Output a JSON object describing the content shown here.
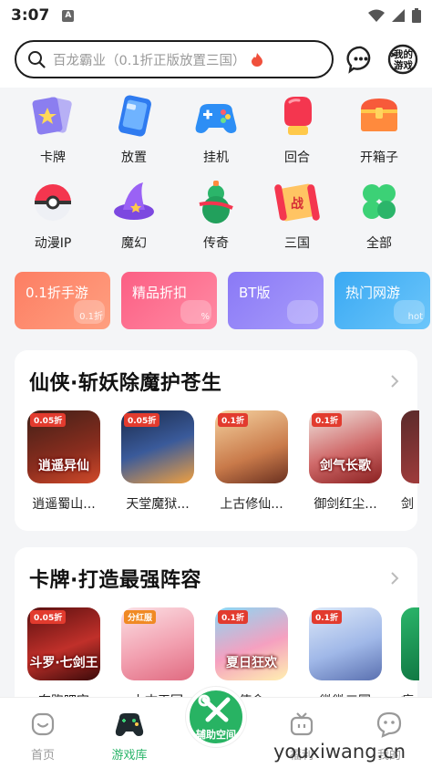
{
  "status": {
    "time": "3:07",
    "notif_letter": "A"
  },
  "search": {
    "placeholder": "百龙霸业（0.1折正版放置三国）"
  },
  "header": {
    "mygame_label_1": "我的",
    "mygame_label_2": "游戏"
  },
  "categories": [
    {
      "label": "卡牌",
      "icon": "cards-icon"
    },
    {
      "label": "放置",
      "icon": "tablet-icon"
    },
    {
      "label": "挂机",
      "icon": "gamepad-icon"
    },
    {
      "label": "回合",
      "icon": "boxing-glove-icon"
    },
    {
      "label": "开箱子",
      "icon": "treasure-chest-icon"
    },
    {
      "label": "动漫IP",
      "icon": "pokeball-icon"
    },
    {
      "label": "魔幻",
      "icon": "wizard-hat-icon"
    },
    {
      "label": "传奇",
      "icon": "gourd-icon"
    },
    {
      "label": "三国",
      "icon": "scroll-icon"
    },
    {
      "label": "全部",
      "icon": "clover-icon"
    }
  ],
  "promos": [
    {
      "label": "0.1折手游",
      "deco": "0.1折",
      "color": "#fd8a6c"
    },
    {
      "label": "精品折扣",
      "deco": "%",
      "color": "#fd6f8d"
    },
    {
      "label": "BT版",
      "deco": "",
      "color": "#9a8cf8"
    },
    {
      "label": "热门网游",
      "deco": "hot",
      "color": "#4fb6f5"
    }
  ],
  "sections": [
    {
      "title": "仙侠·斩妖除魔护苍生",
      "games": [
        {
          "name": "逍遥蜀山...",
          "tag": "0.05折",
          "art": "逍遥异仙"
        },
        {
          "name": "天堂魔狱...",
          "tag": "0.05折",
          "art": ""
        },
        {
          "name": "上古修仙...",
          "tag": "0.1折",
          "art": ""
        },
        {
          "name": "御剑红尘...",
          "tag": "0.1折",
          "art": "剑气长歌"
        },
        {
          "name": "剑",
          "tag": "",
          "art": ""
        }
      ]
    },
    {
      "title": "卡牌·打造最强阵容",
      "games": [
        {
          "name": "奔跑吧突",
          "tag": "0.05折",
          "art": "斗罗·七剑王"
        },
        {
          "name": "上古王冠",
          "tag": "分红服",
          "art": ""
        },
        {
          "name": "使命",
          "tag": "0.1折",
          "art": "夏日狂欢"
        },
        {
          "name": "微微三国",
          "tag": "0.1折",
          "art": ""
        },
        {
          "name": "疯",
          "tag": "",
          "art": ""
        }
      ]
    }
  ],
  "nav": [
    {
      "label": "首页",
      "icon": "home-icon"
    },
    {
      "label": "游戏库",
      "icon": "gamepad-icon"
    },
    {
      "label": "辅助空间",
      "icon": "tools-icon"
    },
    {
      "label": "福利",
      "icon": "tv-icon"
    },
    {
      "label": "我的",
      "icon": "chat-face-icon"
    }
  ],
  "watermark": "youxiwang.cn",
  "colors": {
    "accent": "#2bb56a",
    "tag_red": "#e23b2e"
  }
}
